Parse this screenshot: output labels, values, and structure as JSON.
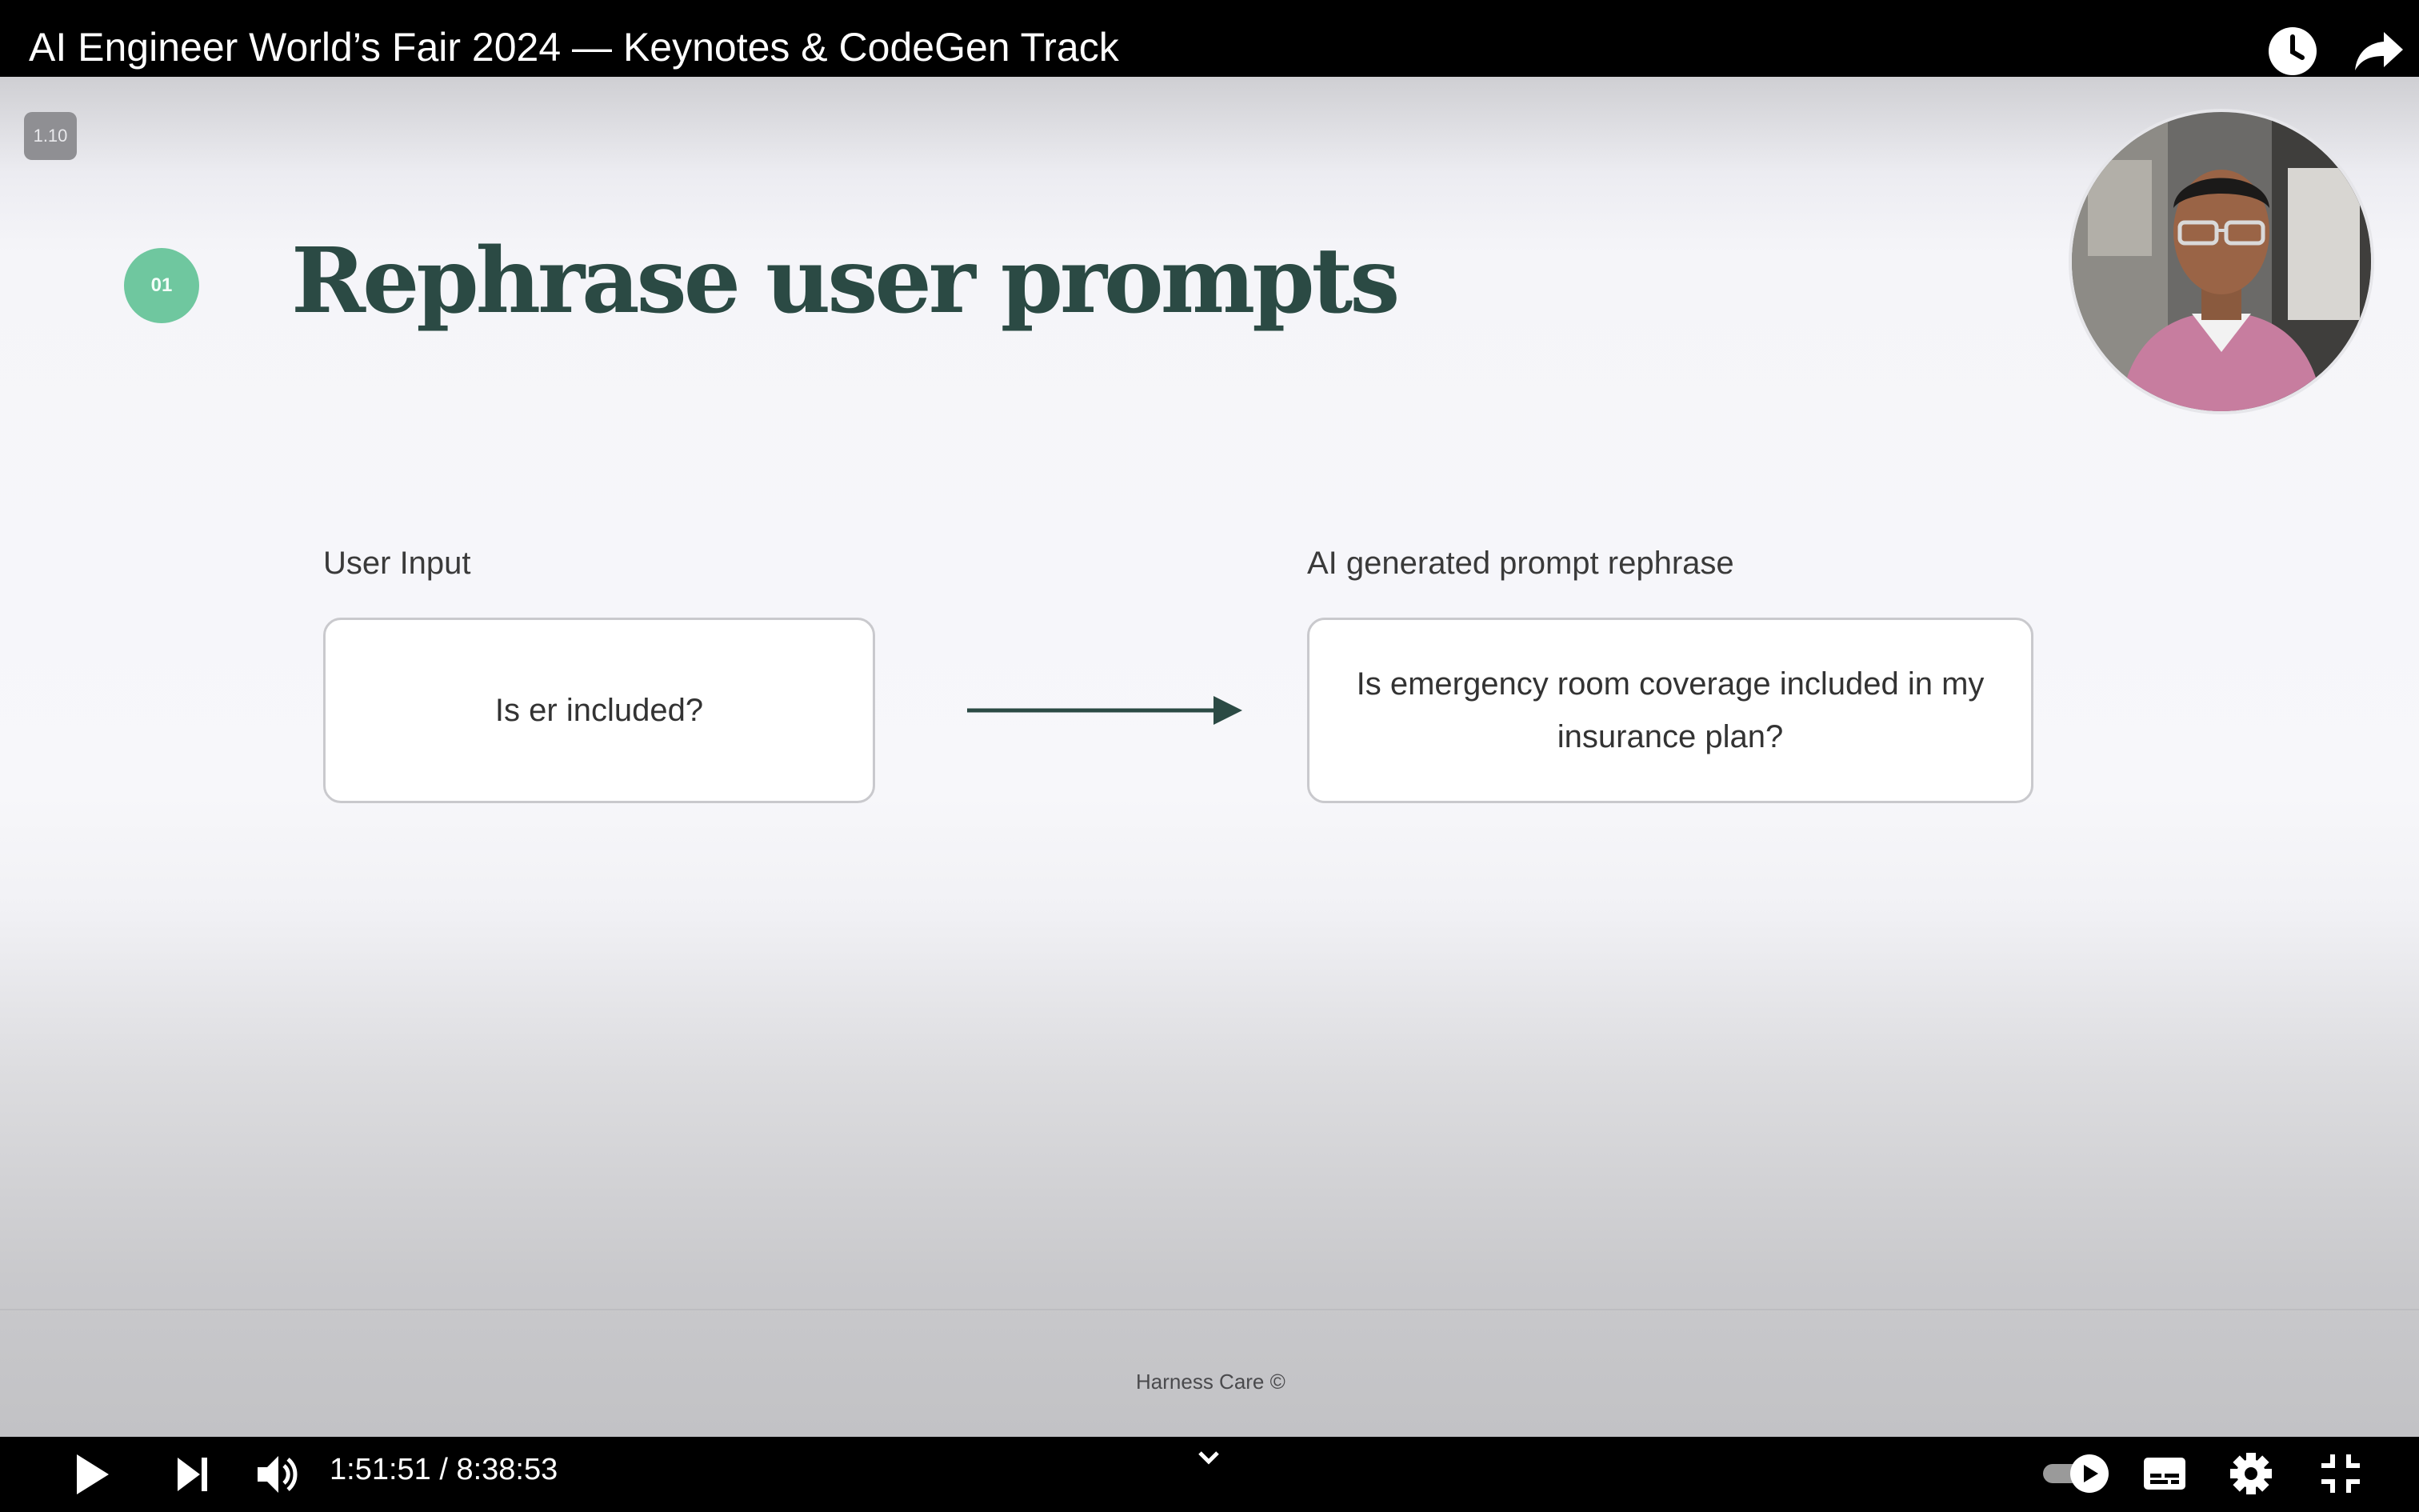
{
  "video": {
    "title": "AI Engineer World’s Fair 2024 — Keynotes & CodeGen Track",
    "speed": "1.10",
    "progress_fraction": 0.219
  },
  "slide": {
    "step_number": "01",
    "title": "Rephrase user prompts",
    "input_label": "User Input",
    "input_text": "Is er included?",
    "output_label": "AI generated prompt rephrase",
    "output_text": "Is emergency room coverage included in my insurance plan?",
    "footer": "Harness Care ©"
  },
  "controls": {
    "time": "1:51:51 / 8:38:53"
  },
  "colors": {
    "title_green": "#2b4a44",
    "step_circle": "#6fc79f",
    "progress_red": "#ff0000"
  },
  "icons": [
    "clock-icon",
    "share-icon",
    "play-icon",
    "next-icon",
    "volume-icon",
    "chevron-down-icon",
    "autoplay-toggle",
    "subtitles-icon",
    "settings-icon",
    "exit-fullscreen-icon"
  ]
}
